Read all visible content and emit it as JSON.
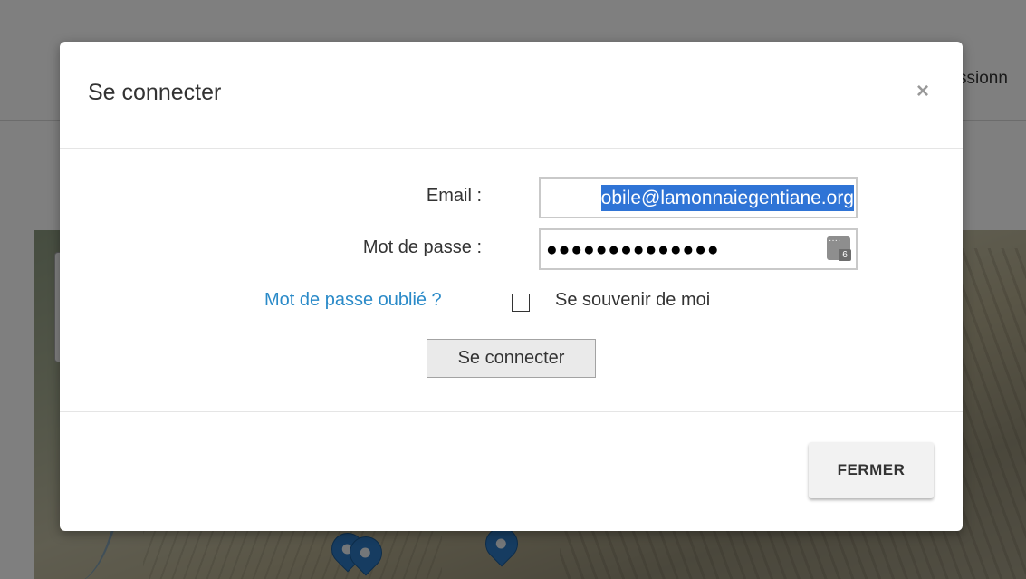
{
  "background": {
    "header_text": "ssionn"
  },
  "modal": {
    "title": "Se connecter",
    "close_label": "×",
    "email": {
      "label": "Email :",
      "value": "obile@lamonnaiegentiane.org"
    },
    "password": {
      "label": "Mot de passe :",
      "value": "●●●●●●●●●●●●●●",
      "manager_badge": "6"
    },
    "forgot_link": "Mot de passe oublié ?",
    "remember_label": "Se souvenir de moi",
    "remember_checked": false,
    "submit_label": "Se connecter",
    "close_button_label": "FERMER"
  },
  "colors": {
    "link": "#2a8ac8",
    "selection": "#2f74d6",
    "marker": "#2d79c3"
  }
}
